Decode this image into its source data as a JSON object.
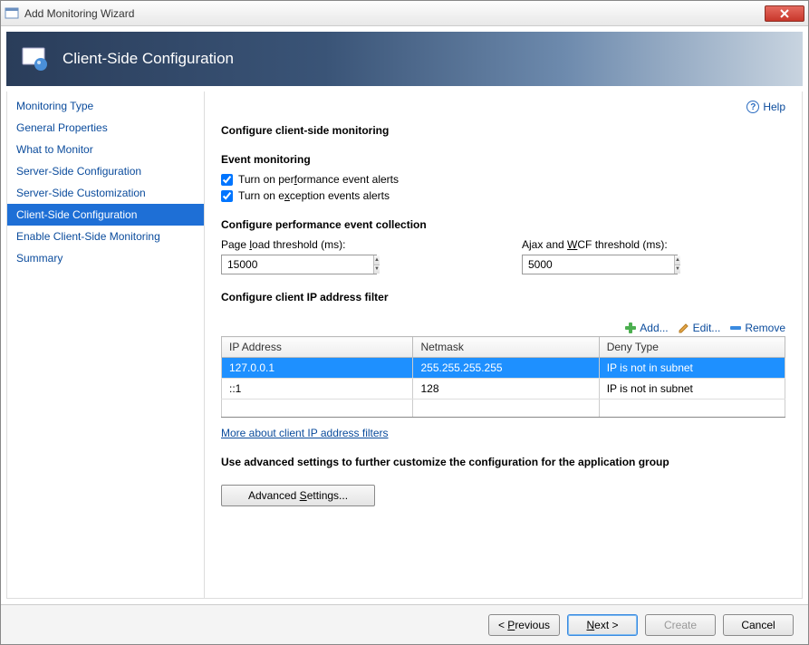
{
  "window": {
    "title": "Add Monitoring Wizard"
  },
  "banner": {
    "title": "Client-Side Configuration"
  },
  "help": {
    "label": "Help"
  },
  "sidebar": {
    "items": [
      {
        "label": "Monitoring Type"
      },
      {
        "label": "General Properties"
      },
      {
        "label": "What to Monitor"
      },
      {
        "label": "Server-Side Configuration"
      },
      {
        "label": "Server-Side Customization"
      },
      {
        "label": "Client-Side Configuration"
      },
      {
        "label": "Enable Client-Side Monitoring"
      },
      {
        "label": "Summary"
      }
    ],
    "selected_index": 5
  },
  "content": {
    "heading": "Configure client-side monitoring",
    "event_monitoring": {
      "title": "Event monitoring",
      "perf_alerts": {
        "checked": true,
        "label_pre": "Turn on per",
        "label_u": "f",
        "label_post": "ormance event alerts"
      },
      "exc_alerts": {
        "checked": true,
        "label_pre": "Turn on e",
        "label_u": "x",
        "label_post": "ception events alerts"
      }
    },
    "perf_collection": {
      "title": "Configure performance event collection",
      "page_load": {
        "label_pre": "Page ",
        "label_u": "l",
        "label_post": "oad threshold (ms):",
        "value": "15000"
      },
      "ajax_wcf": {
        "label_pre": "Ajax and ",
        "label_u": "W",
        "label_post": "CF threshold (ms):",
        "value": "5000"
      }
    },
    "ip_filter": {
      "title": "Configure client IP address filter",
      "toolbar": {
        "add": "Add...",
        "edit": "Edit...",
        "remove": "Remove"
      },
      "columns": {
        "ip": "IP Address",
        "netmask": "Netmask",
        "deny": "Deny Type"
      },
      "rows": [
        {
          "ip": "127.0.0.1",
          "netmask": "255.255.255.255",
          "deny": "IP is not in subnet",
          "selected": true
        },
        {
          "ip": "::1",
          "netmask": "128",
          "deny": "IP is not in subnet",
          "selected": false
        }
      ],
      "more_link": "More about client IP address filters"
    },
    "advanced": {
      "title": "Use advanced settings to further customize the configuration for the application group",
      "button_pre": "Advanced ",
      "button_u": "S",
      "button_post": "ettings..."
    }
  },
  "footer": {
    "previous_pre": "< ",
    "previous_u": "P",
    "previous_post": "revious",
    "next_pre": "",
    "next_u": "N",
    "next_post": "ext >",
    "create": "Create",
    "cancel": "Cancel"
  }
}
